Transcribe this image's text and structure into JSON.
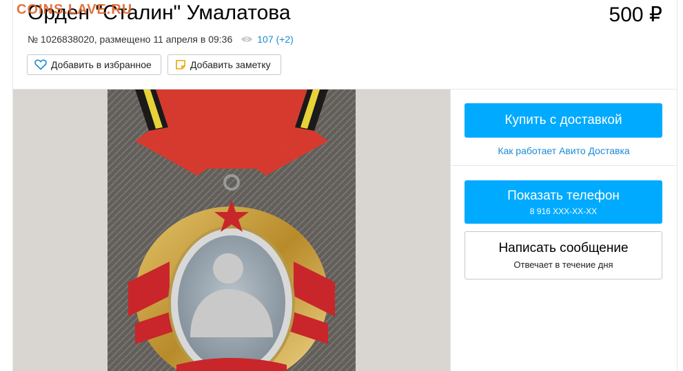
{
  "watermark": "COINS.LAVE.RU",
  "listing": {
    "title": "Орден \"Сталин\" Умалатова",
    "price": "500 ₽",
    "meta": "№ 1026838020, размещено 11 апреля в 09:36",
    "views": "107 (+2)"
  },
  "actions": {
    "favorite_label": "Добавить в избранное",
    "note_label": "Добавить заметку"
  },
  "sidebar": {
    "buy_label": "Купить с доставкой",
    "delivery_link": "Как работает Авито Доставка",
    "phone_label": "Показать телефон",
    "phone_number": "8 916 XXX-XX-XX",
    "message_label": "Написать сообщение",
    "message_sub": "Отвечает в течение дня"
  },
  "colors": {
    "accent": "#00aaff",
    "link": "#1a8ad5",
    "watermark": "#e0652b"
  },
  "icons": [
    "heart-icon",
    "note-icon",
    "eye-icon"
  ]
}
